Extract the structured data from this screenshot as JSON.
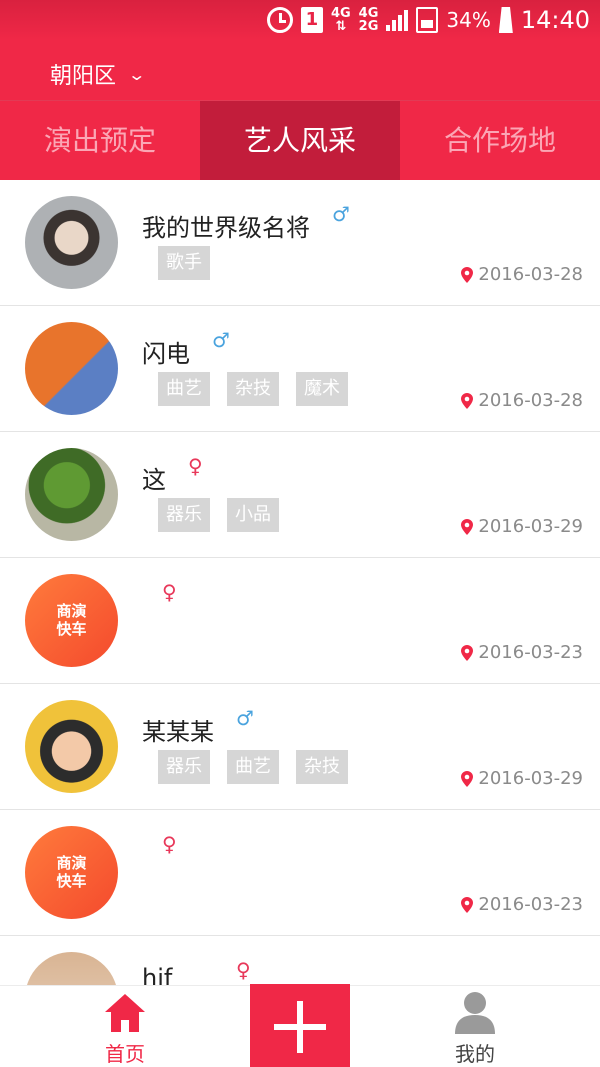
{
  "status_bar": {
    "sim_slot": "1",
    "network_top": "4G",
    "network_second_top": "4G",
    "network_second_bottom": "2G",
    "battery": "34%",
    "time": "14:40"
  },
  "header": {
    "district": "朝阳区"
  },
  "tabs": [
    {
      "label": "演出预定",
      "active": false
    },
    {
      "label": "艺人风采",
      "active": true
    },
    {
      "label": "合作场地",
      "active": false
    }
  ],
  "artists": [
    {
      "name": "我的世界级名将",
      "gender": "male",
      "tags": [
        "歌手"
      ],
      "date": "2016-03-28",
      "avatar": "photo-child"
    },
    {
      "name": "闪电",
      "gender": "male",
      "tags": [
        "曲艺",
        "杂技",
        "魔术"
      ],
      "date": "2016-03-28",
      "avatar": "cartoon-fox"
    },
    {
      "name": "这",
      "gender": "female",
      "tags": [
        "器乐",
        "小品"
      ],
      "date": "2016-03-29",
      "avatar": "photo-plant"
    },
    {
      "name": "",
      "gender": "female",
      "tags": [],
      "date": "2016-03-23",
      "avatar": "default-logo"
    },
    {
      "name": "某某某",
      "gender": "male",
      "tags": [
        "器乐",
        "曲艺",
        "杂技"
      ],
      "date": "2016-03-29",
      "avatar": "cartoon-girl"
    },
    {
      "name": "",
      "gender": "female",
      "tags": [],
      "date": "2016-03-23",
      "avatar": "default-logo"
    },
    {
      "name": "hjf",
      "gender": "female",
      "tags": [],
      "date": "",
      "avatar": "photo-person"
    }
  ],
  "default_avatar_text": {
    "line1": "商演",
    "line2": "快车"
  },
  "bottom_nav": {
    "home": "首页",
    "me": "我的"
  },
  "colors": {
    "primary": "#f02847",
    "active_tab": "#c21d3b",
    "male": "#4aa3de",
    "female": "#e8385a",
    "tag_bg": "#d6d6d6"
  }
}
